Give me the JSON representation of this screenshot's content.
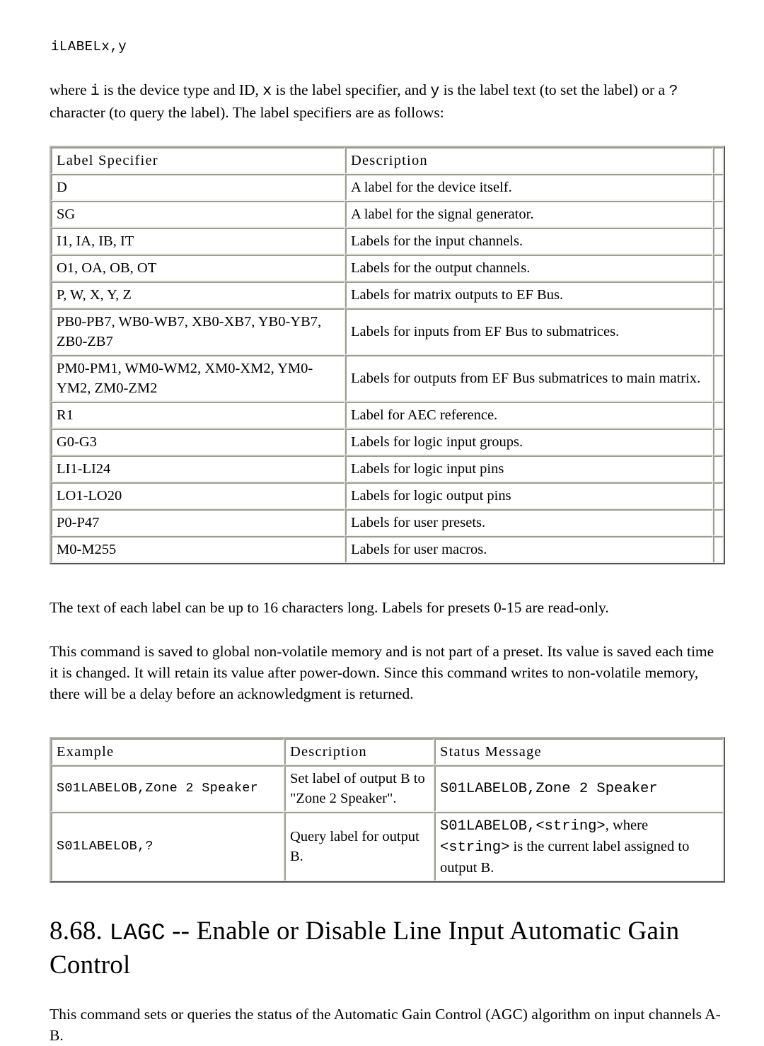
{
  "document": {
    "code_line": "iLABELx,y",
    "intro_paragraph": "where i is the device type and ID, x is the label specifier, and y is the label text (to set the label) or a ? character (to query the label). The label specifiers are as follows:",
    "intro_parts": {
      "p1": "where ",
      "i": "i",
      "p2": " is the device type and ID, ",
      "x": "x",
      "p3": " is the label specifier, and ",
      "y": "y",
      "p4": " is the label text (to set the label) or a ",
      "q": "?",
      "p5": " character (to query the label). The label specifiers are as follows:"
    },
    "note_paragraph": "The text of each label can be up to 16 characters long. Labels for presets 0-15 are read-only.",
    "nonvolatile_paragraph": "This command is saved to global non-volatile memory and is not part of a preset. Its value is saved each time it is changed. It will retain its value after power-down. Since this command writes to non-volatile memory, there will be a delay before an acknowledgment is returned.",
    "section": {
      "number": "8.68.",
      "command": "LAGC",
      "dashes": "--",
      "title": "Enable or Disable Line Input Automatic Gain Control",
      "full_heading": "8.68. LAGC -- Enable or Disable Line Input Automatic Gain Control"
    },
    "section_paragraph": "This command sets or queries the status of the Automatic Gain Control (AGC) algorithm on input channels A-B."
  },
  "label_table": {
    "headers": [
      "Label Specifier",
      "Description",
      ""
    ],
    "rows": [
      {
        "specifier": "D",
        "description": "A label for the device itself."
      },
      {
        "specifier": "SG",
        "description": "A label for the signal generator."
      },
      {
        "specifier": "I1, IA, IB, IT",
        "description": "Labels for the input channels."
      },
      {
        "specifier": "O1, OA, OB, OT",
        "description": "Labels for the output channels."
      },
      {
        "specifier": "P, W, X, Y, Z",
        "description": "Labels for matrix outputs to EF Bus."
      },
      {
        "specifier": "PB0-PB7, WB0-WB7, XB0-XB7, YB0-YB7, ZB0-ZB7",
        "description": "Labels for inputs from EF Bus to submatrices."
      },
      {
        "specifier": "PM0-PM1, WM0-WM2, XM0-XM2, YM0-YM2, ZM0-ZM2",
        "description": "Labels for outputs from EF Bus submatrices to main matrix."
      },
      {
        "specifier": "R1",
        "description": "Label for AEC reference."
      },
      {
        "specifier": "G0-G3",
        "description": "Labels for logic input groups."
      },
      {
        "specifier": "LI1-LI24",
        "description": "Labels for logic input pins"
      },
      {
        "specifier": "LO1-LO20",
        "description": "Labels for logic output pins"
      },
      {
        "specifier": "P0-P47",
        "description": "Labels for user presets."
      },
      {
        "specifier": "M0-M255",
        "description": "Labels for user macros."
      }
    ]
  },
  "example_table": {
    "headers": [
      "Example",
      "Description",
      "Status Message"
    ],
    "rows": [
      {
        "example": "S01LABELOB,Zone 2 Speaker",
        "description": "Set label of output B to \"Zone 2 Speaker\".",
        "status_mono_1": "S01LABELOB,Zone 2 Speaker",
        "status_text_1": "",
        "status_mono_2": "",
        "status_text_2": "",
        "status_mono_3": "",
        "status_text_3": ""
      },
      {
        "example": "S01LABELOB,?",
        "description": "Query label for output B.",
        "status_mono_1": "S01LABELOB,<string>",
        "status_text_1": ", where",
        "status_mono_2": "<string>",
        "status_text_2": " is the current label assigned to",
        "status_mono_3": "",
        "status_text_3": "output B."
      }
    ]
  }
}
